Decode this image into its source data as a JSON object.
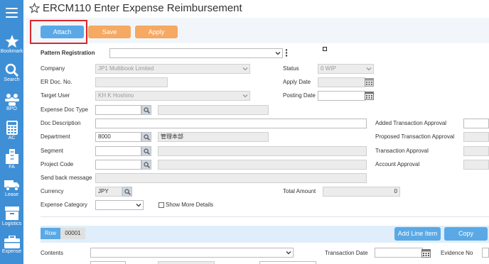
{
  "sidebar": {
    "items": [
      {
        "label": "Bookmark",
        "icon": "star-icon"
      },
      {
        "label": "Search",
        "icon": "search-icon"
      },
      {
        "label": "BPO",
        "icon": "people-icon"
      },
      {
        "label": "AC",
        "icon": "calculator-icon"
      },
      {
        "label": "FA",
        "icon": "building-icon"
      },
      {
        "label": "Lease",
        "icon": "truck-icon"
      },
      {
        "label": "Logistics",
        "icon": "boxes-icon"
      },
      {
        "label": "Expense",
        "icon": "briefcase-icon"
      }
    ]
  },
  "header": {
    "title": "ERCM110 Enter Expense Reimbursement"
  },
  "toolbar": {
    "attach": "Attach",
    "save": "Save",
    "apply": "Apply"
  },
  "form": {
    "pattern_registration": {
      "label": "Pattern Registration",
      "value": ""
    },
    "company": {
      "label": "Company",
      "value": "JP1 Multibook Limited"
    },
    "status": {
      "label": "Status",
      "value": "0 WIP"
    },
    "er_doc_no": {
      "label": "ER Doc. No.",
      "value": ""
    },
    "apply_date": {
      "label": "Apply Date",
      "value": ""
    },
    "target_user": {
      "label": "Target User",
      "value": "KH K Hoshino"
    },
    "posting_date": {
      "label": "Posting Date",
      "value": ""
    },
    "expense_doc_type": {
      "label": "Expense Doc Type",
      "value": ""
    },
    "doc_description": {
      "label": "Doc Description",
      "value": ""
    },
    "added_transaction_approval": {
      "label": "Added Transaction Approval",
      "value": ""
    },
    "department": {
      "label": "Department",
      "value": "8000",
      "name": "管理本部"
    },
    "proposed_transaction_approval": {
      "label": "Proposed Transaction Approval",
      "value": ""
    },
    "segment": {
      "label": "Segment",
      "value": ""
    },
    "transaction_approval": {
      "label": "Transaction Approval",
      "value": ""
    },
    "project_code": {
      "label": "Project Code",
      "value": ""
    },
    "account_approval": {
      "label": "Account Approval",
      "value": ""
    },
    "send_back_message": {
      "label": "Send back message",
      "value": ""
    },
    "currency": {
      "label": "Currency",
      "value": "JPY"
    },
    "total_amount": {
      "label": "Total Amount",
      "value": "0"
    },
    "expense_category": {
      "label": "Expense Category",
      "value": ""
    },
    "show_more_details": {
      "label": "Show More Details",
      "checked": false
    }
  },
  "lines": {
    "row_label": "Row",
    "row_number": "00001",
    "add_line_item": "Add Line Item",
    "copy": "Copy",
    "contents_label": "Contents",
    "transaction_date_label": "Transaction Date",
    "evidence_no_label": "Evidence No"
  },
  "colors": {
    "sidebar": "#3f8fd6",
    "primary_button": "#5aa9e6",
    "secondary_button": "#f5a962",
    "highlight": "#e0252b"
  }
}
